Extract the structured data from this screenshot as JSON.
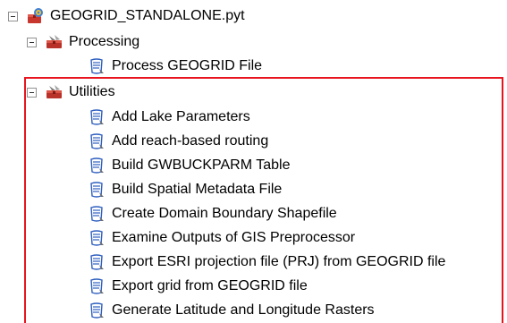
{
  "tree": {
    "root": {
      "label": "GEOGRID_STANDALONE.pyt",
      "expanded": true,
      "icon": "python-toolbox-icon"
    },
    "toolsets": [
      {
        "label": "Processing",
        "expanded": true,
        "icon": "toolset-icon",
        "tools": [
          {
            "label": "Process GEOGRID File",
            "icon": "script-tool-icon"
          }
        ]
      },
      {
        "label": "Utilities",
        "expanded": true,
        "icon": "toolset-icon",
        "tools": [
          {
            "label": "Add Lake Parameters",
            "icon": "script-tool-icon"
          },
          {
            "label": "Add reach-based routing",
            "icon": "script-tool-icon"
          },
          {
            "label": "Build GWBUCKPARM Table",
            "icon": "script-tool-icon"
          },
          {
            "label": "Build Spatial Metadata File",
            "icon": "script-tool-icon"
          },
          {
            "label": "Create Domain Boundary Shapefile",
            "icon": "script-tool-icon"
          },
          {
            "label": "Examine Outputs of GIS Preprocessor",
            "icon": "script-tool-icon"
          },
          {
            "label": "Export ESRI projection file (PRJ) from GEOGRID file",
            "icon": "script-tool-icon"
          },
          {
            "label": "Export grid from GEOGRID file",
            "icon": "script-tool-icon"
          },
          {
            "label": "Generate Latitude and Longitude Rasters",
            "icon": "script-tool-icon"
          }
        ]
      }
    ]
  },
  "colors": {
    "highlight_border": "#e8141e",
    "expander_border": "#919191",
    "toolset_red": "#c8372d",
    "script_blue": "#2f5fbf"
  }
}
